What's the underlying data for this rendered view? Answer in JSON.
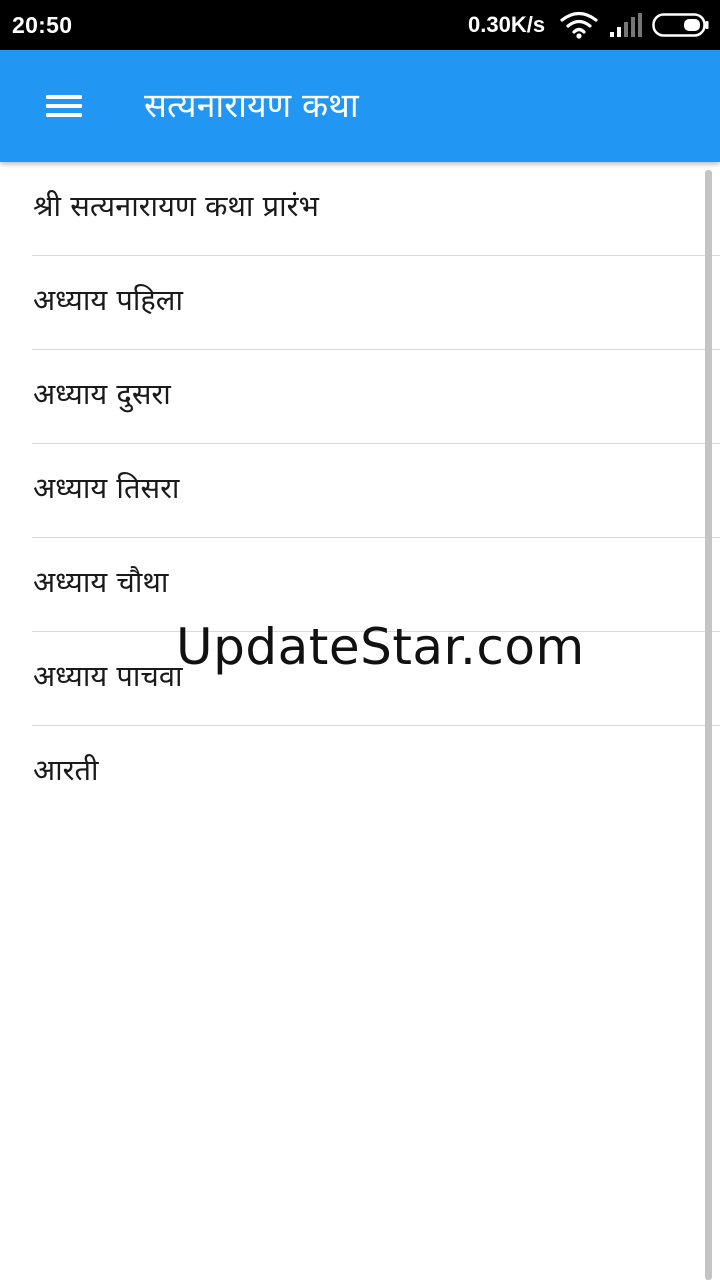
{
  "status_bar": {
    "time": "20:50",
    "network_speed": "0.30K/s",
    "icons": [
      "wifi-icon",
      "signal-icon",
      "battery-icon"
    ]
  },
  "app_bar": {
    "title": "सत्यनारायण कथा",
    "menu_icon": "menu-icon",
    "background_color": "#2196F3"
  },
  "chapters": [
    {
      "label": "श्री सत्यनारायण कथा प्रारंभ"
    },
    {
      "label": "अध्याय पहिला"
    },
    {
      "label": "अध्याय दुसरा"
    },
    {
      "label": "अध्याय तिसरा"
    },
    {
      "label": "अध्याय चौथा"
    },
    {
      "label": "अध्याय पाचवा"
    },
    {
      "label": "आरती"
    }
  ],
  "watermark": {
    "text": "UpdateStar.com"
  }
}
